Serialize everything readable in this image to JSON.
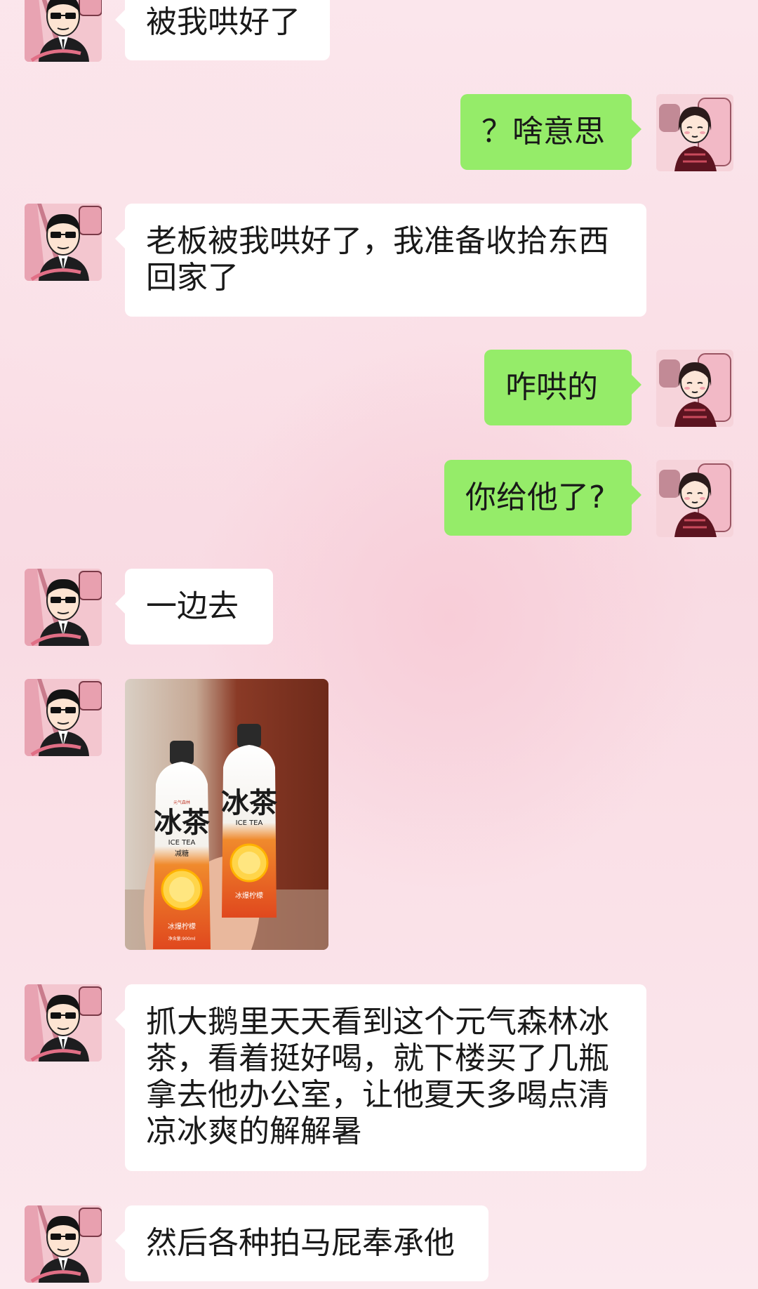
{
  "messages": [
    {
      "side": "left",
      "sender": "male",
      "type": "text",
      "text": "被我哄好了"
    },
    {
      "side": "right",
      "sender": "female",
      "type": "text",
      "text": "？啥意思"
    },
    {
      "side": "left",
      "sender": "male",
      "type": "text",
      "text": "老板被我哄好了，我准备收拾东西回家了"
    },
    {
      "side": "right",
      "sender": "female",
      "type": "text",
      "text": "咋哄的"
    },
    {
      "side": "right",
      "sender": "female",
      "type": "text",
      "text": "你给他了?"
    },
    {
      "side": "left",
      "sender": "male",
      "type": "text",
      "text": "一边去"
    },
    {
      "side": "left",
      "sender": "male",
      "type": "image",
      "image": {
        "description_labels": {
          "brand": "元气森林",
          "product": "冰茶",
          "product_en": "ICE TEA",
          "variant": "减糖",
          "flavor": "冰爆柠檬",
          "volume": "净含量:900ml"
        }
      }
    },
    {
      "side": "left",
      "sender": "male",
      "type": "text",
      "text": "抓大鹅里天天看到这个元气森林冰茶，看着挺好喝，就下楼买了几瓶拿去他办公室，让他夏天多喝点清凉冰爽的解解暑"
    },
    {
      "side": "left",
      "sender": "male",
      "type": "text",
      "text": "然后各种拍马屁奉承他"
    }
  ],
  "colors": {
    "bubble_self": "#95ec69",
    "bubble_other": "#ffffff",
    "text": "#191919"
  },
  "icons": {
    "male_avatar": "avatar-man-sunglasses-icon",
    "female_avatar": "avatar-girl-icon"
  }
}
